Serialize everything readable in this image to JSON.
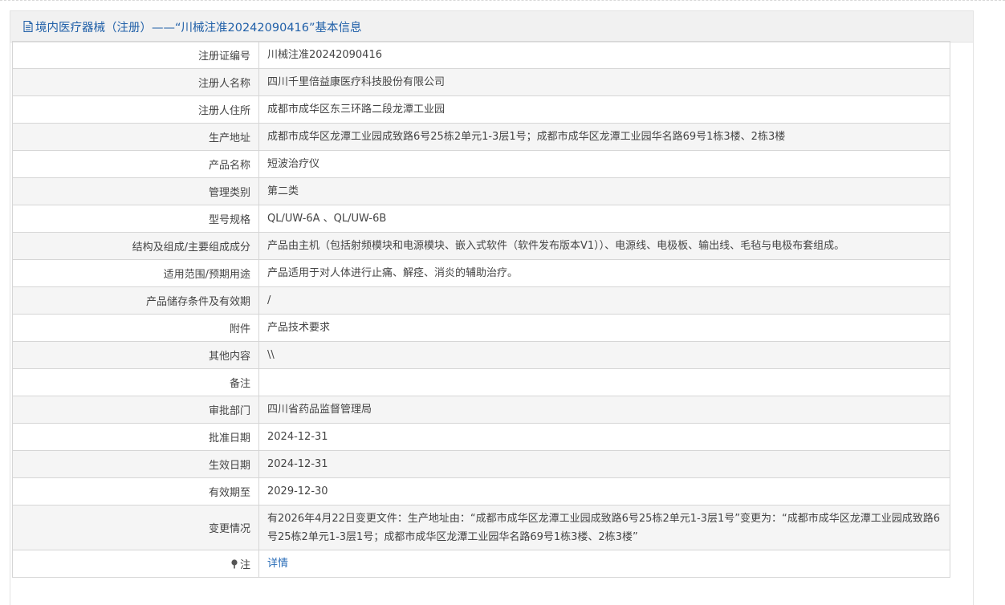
{
  "header": {
    "title": "境内医疗器械（注册）——“川械注准20242090416”基本信息",
    "accent_color": "#1f5fa8"
  },
  "rows": [
    {
      "label": "注册证编号",
      "value": "川械注准20242090416"
    },
    {
      "label": "注册人名称",
      "value": "四川千里倍益康医疗科技股份有限公司"
    },
    {
      "label": "注册人住所",
      "value": "成都市成华区东三环路二段龙潭工业园"
    },
    {
      "label": "生产地址",
      "value": "成都市成华区龙潭工业园成致路6号25栋2单元1-3层1号；成都市成华区龙潭工业园华名路69号1栋3楼、2栋3楼"
    },
    {
      "label": "产品名称",
      "value": "短波治疗仪"
    },
    {
      "label": "管理类别",
      "value": "第二类"
    },
    {
      "label": "型号规格",
      "value": "QL/UW-6A 、QL/UW-6B"
    },
    {
      "label": "结构及组成/主要组成成分",
      "value": "产品由主机（包括射频模块和电源模块、嵌入式软件（软件发布版本V1））、电源线、电极板、输出线、毛毡与电极布套组成。"
    },
    {
      "label": "适用范围/预期用途",
      "value": "产品适用于对人体进行止痛、解痉、消炎的辅助治疗。"
    },
    {
      "label": "产品储存条件及有效期",
      "value": "/"
    },
    {
      "label": "附件",
      "value": "产品技术要求"
    },
    {
      "label": "其他内容",
      "value": "\\\\"
    },
    {
      "label": "备注",
      "value": ""
    },
    {
      "label": "审批部门",
      "value": "四川省药品监督管理局"
    },
    {
      "label": "批准日期",
      "value": "2024-12-31"
    },
    {
      "label": "生效日期",
      "value": "2024-12-31"
    },
    {
      "label": "有效期至",
      "value": "2029-12-30"
    },
    {
      "label": "变更情况",
      "value": "有2026年4月22日变更文件：生产地址由：“成都市成华区龙潭工业园成致路6号25栋2单元1-3层1号”变更为：“成都市成华区龙潭工业园成致路6号25栋2单元1-3层1号；成都市成华区龙潭工业园华名路69号1栋3楼、2栋3楼”"
    }
  ],
  "note_row": {
    "label": "注",
    "link": "详情",
    "icon": "pin-icon"
  }
}
